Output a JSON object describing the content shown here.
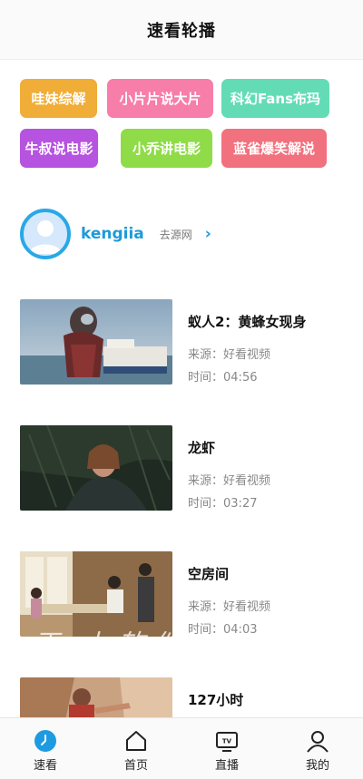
{
  "header": {
    "title": "速看轮播"
  },
  "tags": [
    {
      "label": "哇妹综解",
      "color": "#f0ad37"
    },
    {
      "label": "小片片说大片",
      "color": "#f67ea9"
    },
    {
      "label": "科幻Fans布玛",
      "color": "#63dcb5"
    },
    {
      "label": "牛叔说电影",
      "color": "#b653e0"
    },
    {
      "label": "小乔讲电影",
      "color": "#8fdc48"
    },
    {
      "label": "蓝雀爆笑解说",
      "color": "#f2717e"
    }
  ],
  "uploader": {
    "name": "kengiia",
    "link": "去源网",
    "chevron": "›"
  },
  "videos": [
    {
      "title": "蚁人2：黄蜂女现身",
      "source_label": "来源：",
      "source": "好看视频",
      "time_label": "时间：",
      "time": "04:56"
    },
    {
      "title": "龙虾",
      "source_label": "来源：",
      "source": "好看视频",
      "time_label": "时间：",
      "time": "03:27"
    },
    {
      "title": "空房间",
      "source_label": "来源：",
      "source": "好看视频",
      "time_label": "时间：",
      "time": "04:03"
    },
    {
      "title": "127小时"
    }
  ],
  "watermark": "王·九软件",
  "tabbar": {
    "items": [
      {
        "label": "速看",
        "icon": "clock-icon",
        "active": true
      },
      {
        "label": "首页",
        "icon": "home-icon"
      },
      {
        "label": "直播",
        "icon": "tv-icon"
      },
      {
        "label": "我的",
        "icon": "user-icon"
      }
    ]
  },
  "colors": {
    "accent": "#1d9bd8",
    "tab_active": "#1e9be0"
  }
}
